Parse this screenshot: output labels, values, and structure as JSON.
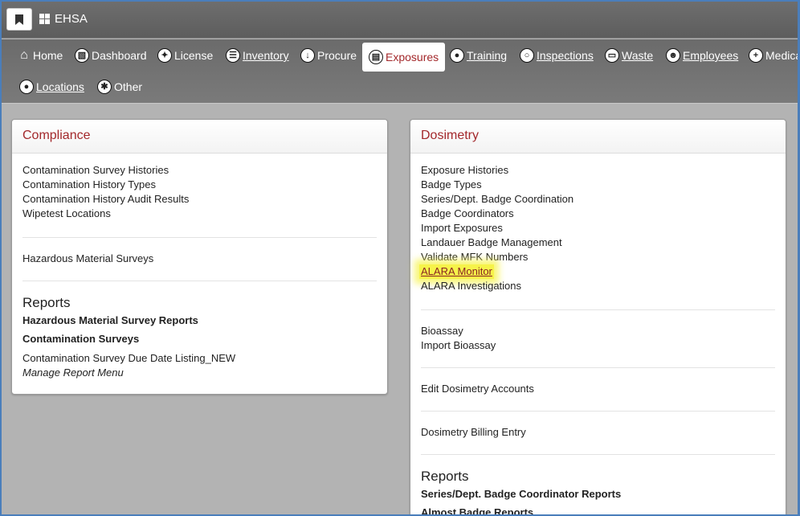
{
  "app": {
    "title": "EHSA"
  },
  "nav": {
    "items": [
      {
        "label": "Home",
        "icon": "home-icon"
      },
      {
        "label": "Dashboard",
        "icon": "dashboard-icon"
      },
      {
        "label": "License",
        "icon": "wrench-icon"
      },
      {
        "label": "Inventory",
        "icon": "inventory-icon"
      },
      {
        "label": "Procure",
        "icon": "download-icon"
      },
      {
        "label": "Exposures",
        "icon": "clipboard-icon"
      },
      {
        "label": "Training",
        "icon": "training-icon"
      },
      {
        "label": "Inspections",
        "icon": "search-icon"
      },
      {
        "label": "Waste",
        "icon": "trash-icon"
      },
      {
        "label": "Employees",
        "icon": "users-icon"
      },
      {
        "label": "Medica",
        "icon": "plus-icon"
      },
      {
        "label": "Locations",
        "icon": "map-marker-icon"
      },
      {
        "label": "Other",
        "icon": "asterisk-icon"
      }
    ],
    "active": "Exposures",
    "active_color": "#a3282b"
  },
  "compliance": {
    "title": "Compliance",
    "group1": [
      "Contamination Survey Histories",
      "Contamination History Types",
      "Contamination History Audit Results",
      "Wipetest Locations"
    ],
    "group2": [
      "Hazardous Material Surveys"
    ],
    "reports_title": "Reports",
    "report_heading1": "Hazardous Material Survey Reports",
    "report_heading2": "Contamination Surveys",
    "report_link": "Contamination Survey Due Date Listing_NEW",
    "manage_link": "Manage Report Menu"
  },
  "dosimetry": {
    "title": "Dosimetry",
    "group1": [
      "Exposure Histories",
      "Badge Types",
      "Series/Dept. Badge Coordination",
      "Badge Coordinators",
      "Import Exposures",
      "Landauer Badge Management",
      "Validate MFK Numbers",
      "ALARA Monitor",
      "ALARA Investigations"
    ],
    "highlighted": "ALARA Monitor",
    "group2": [
      "Bioassay",
      "Import Bioassay"
    ],
    "group3": [
      "Edit Dosimetry Accounts"
    ],
    "group4": [
      "Dosimetry Billing Entry"
    ],
    "reports_title": "Reports",
    "report_heading1": "Series/Dept. Badge Coordinator Reports",
    "report_heading2_partial": "Almost Badge Reports"
  },
  "colors": {
    "accent": "#a3282b",
    "highlight": "#f6f34a",
    "frame": "#4a7ebb"
  }
}
